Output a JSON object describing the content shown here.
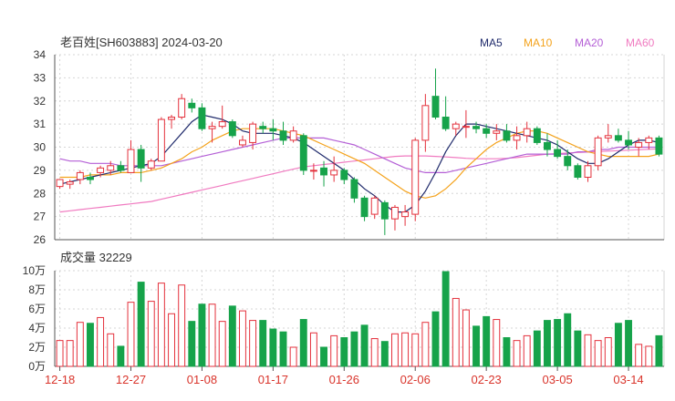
{
  "header": {
    "title": "老百姓[SH603883] 2024-03-20"
  },
  "legend": [
    {
      "label": "MA5",
      "color": "#1f2a6b"
    },
    {
      "label": "MA10",
      "color": "#f4a21b"
    },
    {
      "label": "MA20",
      "color": "#b45fd6"
    },
    {
      "label": "MA60",
      "color": "#f07ac0"
    }
  ],
  "colors": {
    "up": "#e4313c",
    "down": "#16a34a",
    "grid": "#d6d6d6",
    "axis": "#555555"
  },
  "chart_data": [
    {
      "type": "candlestick",
      "title": "老百姓[SH603883] 2024-03-20",
      "ylim": [
        26,
        34
      ],
      "yticks": [
        "34",
        "33",
        "32",
        "31",
        "30",
        "29",
        "28",
        "27",
        "26"
      ],
      "x_labels": [
        "12-18",
        "12-27",
        "01-08",
        "01-17",
        "01-26",
        "02-06",
        "02-23",
        "03-05",
        "03-14"
      ],
      "x_label_index": [
        0,
        7,
        14,
        21,
        28,
        35,
        42,
        49,
        56
      ],
      "ohlc": [
        [
          28.3,
          28.6,
          28.2,
          28.6
        ],
        [
          28.4,
          28.6,
          28.2,
          28.5
        ],
        [
          28.6,
          29.0,
          28.4,
          28.9
        ],
        [
          28.7,
          28.9,
          28.4,
          28.6
        ],
        [
          28.9,
          29.2,
          28.7,
          29.1
        ],
        [
          29.0,
          29.4,
          28.8,
          29.2
        ],
        [
          29.2,
          29.4,
          28.9,
          29.0
        ],
        [
          28.9,
          30.3,
          28.9,
          29.9
        ],
        [
          29.9,
          30.1,
          28.5,
          29.1
        ],
        [
          29.1,
          29.5,
          29.0,
          29.4
        ],
        [
          29.4,
          31.3,
          29.4,
          31.2
        ],
        [
          31.2,
          31.4,
          30.8,
          31.3
        ],
        [
          31.3,
          32.3,
          31.2,
          32.1
        ],
        [
          31.9,
          32.1,
          31.5,
          31.7
        ],
        [
          31.7,
          31.9,
          30.7,
          30.8
        ],
        [
          30.8,
          31.1,
          30.2,
          30.9
        ],
        [
          30.9,
          31.8,
          30.8,
          31.1
        ],
        [
          31.1,
          31.2,
          30.4,
          30.5
        ],
        [
          30.1,
          30.5,
          30.0,
          30.3
        ],
        [
          30.2,
          31.1,
          29.9,
          31.0
        ],
        [
          30.9,
          31.1,
          30.6,
          30.8
        ],
        [
          30.8,
          31.2,
          30.3,
          30.7
        ],
        [
          30.7,
          31.1,
          30.1,
          30.3
        ],
        [
          30.3,
          30.9,
          30.2,
          30.7
        ],
        [
          30.5,
          30.6,
          28.8,
          29.0
        ],
        [
          29.0,
          29.3,
          28.6,
          29.0
        ],
        [
          29.1,
          29.4,
          28.3,
          28.8
        ],
        [
          28.8,
          29.6,
          28.5,
          29.0
        ],
        [
          29.0,
          29.1,
          28.4,
          28.6
        ],
        [
          28.6,
          28.7,
          27.6,
          27.8
        ],
        [
          27.8,
          27.9,
          26.8,
          27.0
        ],
        [
          27.1,
          27.9,
          26.9,
          27.8
        ],
        [
          27.6,
          27.7,
          26.2,
          26.9
        ],
        [
          26.9,
          27.5,
          26.4,
          27.4
        ],
        [
          27.0,
          27.5,
          26.6,
          27.2
        ],
        [
          27.1,
          30.4,
          26.8,
          30.3
        ],
        [
          30.3,
          32.3,
          29.8,
          31.8
        ],
        [
          32.2,
          33.4,
          31.2,
          31.3
        ],
        [
          31.3,
          32.2,
          30.7,
          30.8
        ],
        [
          30.8,
          31.1,
          30.5,
          31.0
        ],
        [
          30.9,
          31.6,
          30.4,
          30.9
        ],
        [
          30.9,
          31.1,
          30.6,
          30.8
        ],
        [
          30.8,
          31.0,
          30.4,
          30.6
        ],
        [
          30.6,
          31.0,
          30.3,
          30.7
        ],
        [
          30.7,
          31.0,
          30.2,
          30.3
        ],
        [
          30.3,
          30.9,
          29.9,
          30.5
        ],
        [
          30.5,
          31.1,
          30.2,
          30.8
        ],
        [
          30.8,
          30.9,
          30.1,
          30.2
        ],
        [
          30.2,
          30.6,
          29.6,
          29.9
        ],
        [
          29.9,
          30.3,
          29.5,
          29.6
        ],
        [
          29.6,
          29.9,
          29.0,
          29.2
        ],
        [
          29.2,
          29.3,
          28.6,
          28.7
        ],
        [
          28.7,
          29.4,
          28.5,
          29.2
        ],
        [
          29.2,
          30.5,
          29.0,
          30.4
        ],
        [
          30.4,
          31.0,
          30.2,
          30.5
        ],
        [
          30.5,
          30.8,
          30.2,
          30.3
        ],
        [
          30.3,
          30.7,
          29.9,
          30.1
        ],
        [
          30.0,
          30.4,
          29.6,
          30.2
        ],
        [
          30.2,
          30.5,
          29.9,
          30.4
        ],
        [
          30.4,
          30.5,
          29.6,
          29.7
        ]
      ],
      "ma5": [
        28.4,
        28.5,
        28.6,
        28.7,
        28.8,
        28.9,
        29.0,
        29.1,
        29.2,
        29.3,
        29.6,
        30.1,
        30.6,
        31.1,
        31.4,
        31.3,
        31.2,
        31.0,
        30.7,
        30.6,
        30.6,
        30.6,
        30.5,
        30.4,
        30.2,
        29.9,
        29.6,
        29.3,
        29.0,
        28.6,
        28.2,
        27.9,
        27.5,
        27.2,
        27.2,
        27.5,
        28.1,
        28.9,
        29.8,
        30.5,
        31.0,
        31.0,
        30.9,
        30.8,
        30.7,
        30.6,
        30.5,
        30.4,
        30.3,
        30.1,
        29.8,
        29.5,
        29.3,
        29.3,
        29.5,
        29.8,
        30.1,
        30.3,
        30.3,
        30.2
      ],
      "ma10": [
        28.7,
        28.7,
        28.7,
        28.8,
        28.8,
        28.8,
        28.9,
        28.9,
        28.9,
        29.0,
        29.1,
        29.3,
        29.5,
        29.8,
        30.0,
        30.3,
        30.5,
        30.7,
        30.8,
        30.8,
        30.8,
        30.8,
        30.7,
        30.6,
        30.5,
        30.3,
        30.1,
        29.9,
        29.7,
        29.5,
        29.3,
        29.0,
        28.7,
        28.4,
        28.1,
        27.9,
        27.8,
        27.9,
        28.2,
        28.6,
        29.1,
        29.5,
        29.9,
        30.2,
        30.4,
        30.6,
        30.7,
        30.7,
        30.6,
        30.4,
        30.2,
        30.0,
        29.8,
        29.7,
        29.6,
        29.6,
        29.6,
        29.6,
        29.6,
        29.7
      ],
      "ma20": [
        29.5,
        29.4,
        29.4,
        29.3,
        29.3,
        29.3,
        29.2,
        29.2,
        29.2,
        29.2,
        29.2,
        29.3,
        29.4,
        29.5,
        29.6,
        29.7,
        29.8,
        29.9,
        30.0,
        30.1,
        30.2,
        30.3,
        30.4,
        30.4,
        30.4,
        30.4,
        30.4,
        30.3,
        30.2,
        30.1,
        29.9,
        29.7,
        29.5,
        29.3,
        29.1,
        29.0,
        28.9,
        28.9,
        28.9,
        29.0,
        29.1,
        29.2,
        29.3,
        29.4,
        29.5,
        29.6,
        29.7,
        29.7,
        29.7,
        29.7,
        29.7,
        29.8,
        29.8,
        29.9,
        29.9,
        30.0,
        30.0,
        30.0,
        30.0,
        30.0
      ],
      "ma60": [
        27.2,
        27.25,
        27.3,
        27.35,
        27.4,
        27.45,
        27.5,
        27.55,
        27.6,
        27.65,
        27.75,
        27.85,
        27.95,
        28.05,
        28.15,
        28.25,
        28.35,
        28.45,
        28.55,
        28.65,
        28.75,
        28.85,
        28.95,
        29.05,
        29.15,
        29.2,
        29.25,
        29.3,
        29.35,
        29.4,
        29.45,
        29.5,
        29.55,
        29.6,
        29.62,
        29.62,
        29.62,
        29.6,
        29.58,
        29.55,
        29.52,
        29.5,
        29.5,
        29.5,
        29.52,
        29.55,
        29.6,
        29.65,
        29.7,
        29.72,
        29.75,
        29.77,
        29.79,
        29.81,
        29.83,
        29.85,
        29.87,
        29.89,
        29.91,
        29.93
      ]
    },
    {
      "type": "bar",
      "title": "成交量 32229",
      "ylim": [
        0,
        10
      ],
      "unit": "万",
      "yticks": [
        "10万",
        "8万",
        "6万",
        "4万",
        "2万",
        "0万"
      ],
      "values": [
        2.7,
        2.7,
        4.6,
        4.5,
        5.1,
        3.4,
        2.1,
        6.7,
        8.8,
        6.8,
        8.7,
        5.5,
        8.5,
        4.7,
        6.5,
        6.5,
        4.7,
        6.3,
        5.8,
        4.8,
        4.8,
        3.9,
        3.6,
        2.0,
        4.9,
        3.5,
        2.0,
        3.2,
        3.0,
        3.6,
        4.3,
        2.9,
        2.6,
        3.4,
        3.5,
        3.4,
        4.6,
        5.7,
        9.9,
        7.1,
        5.9,
        4.2,
        5.2,
        4.9,
        3.0,
        2.7,
        3.2,
        3.7,
        4.8,
        4.9,
        5.5,
        3.7,
        3.3,
        2.7,
        3.0,
        4.5,
        4.8,
        2.3,
        2.1,
        3.2
      ],
      "colors": "up red outline, down green filled"
    }
  ]
}
